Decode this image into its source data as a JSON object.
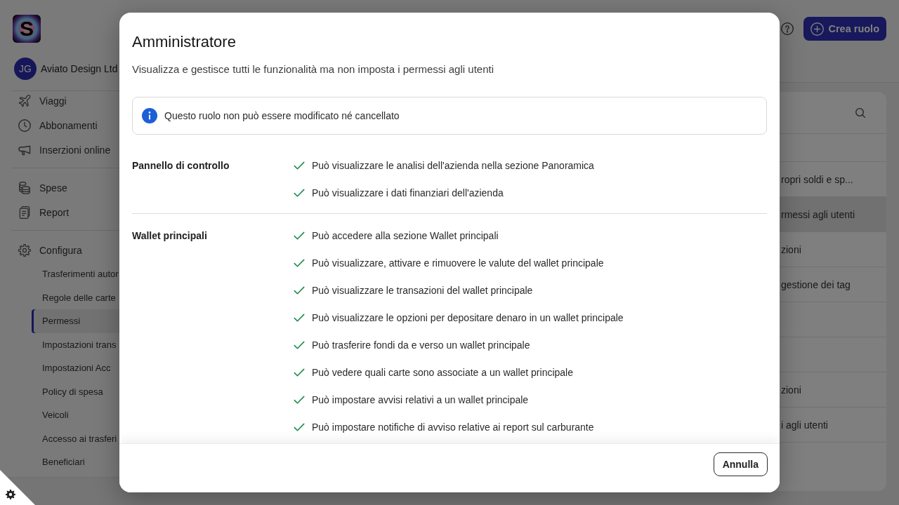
{
  "sidebar": {
    "logo": {
      "letter": "S"
    },
    "account": {
      "initials": "JG",
      "name": "Aviato Design Ltd"
    },
    "nav_groups": [
      {
        "items": [
          {
            "label": "Viaggi",
            "selected": false
          },
          {
            "label": "Abbonamenti",
            "selected": false
          },
          {
            "label": "Inserzioni online",
            "selected": false
          }
        ]
      },
      {
        "items": [
          {
            "label": "Spese",
            "selected": false
          },
          {
            "label": "Report",
            "selected": false
          }
        ]
      },
      {
        "items": [
          {
            "label": "Configura",
            "selected": false,
            "children": [
              {
                "label": "Trasferimenti autor",
                "selected": false
              },
              {
                "label": "Regole delle carte",
                "selected": false
              },
              {
                "label": "Permessi",
                "selected": true
              },
              {
                "label": "Impostazioni trans",
                "selected": false
              },
              {
                "label": "Impostazioni Acc",
                "selected": false
              },
              {
                "label": "Policy di spesa",
                "selected": false
              },
              {
                "label": "Veicoli",
                "selected": false
              },
              {
                "label": "Accesso ai trasferi",
                "selected": false
              },
              {
                "label": "Beneficiari",
                "selected": false
              }
            ]
          }
        ]
      }
    ]
  },
  "header": {
    "create_button": {
      "label": "Crea ruolo"
    }
  },
  "roles_list": {
    "rows": [
      {
        "text": "ropri soldi e sp...",
        "selected": false
      },
      {
        "text": "rmessi agli utenti",
        "selected": true
      },
      {
        "text": "zioni",
        "selected": false
      },
      {
        "text": "gestione dei tag",
        "selected": false
      },
      {
        "selected": false
      },
      {
        "selected": false
      },
      {
        "text": "zioni",
        "selected": false
      },
      {
        "text": "i agli utenti",
        "selected": false
      }
    ]
  },
  "dialog": {
    "title": "Amministratore",
    "description": "Visualizza e gestisce tutti le funzionalità ma non imposta i permessi agli utenti",
    "notice": "Questo ruolo non può essere modificato né cancellato",
    "sections": [
      {
        "name": "Pannello di controllo",
        "permissions": [
          "Può visualizzare le analisi dell'azienda nella sezione Panoramica",
          "Può visualizzare i dati finanziari dell'azienda"
        ]
      },
      {
        "name": "Wallet principali",
        "permissions": [
          "Può accedere alla sezione Wallet principali",
          "Può visualizzare, attivare e rimuovere le valute del wallet principale",
          "Può visualizzare le transazioni del wallet principale",
          "Può visualizzare le opzioni per depositare denaro in un wallet principale",
          "Può trasferire fondi da e verso un wallet principale",
          "Può vedere quali carte sono associate a un wallet principale",
          "Può impostare avvisi relativi a un wallet principale",
          "Può impostare notifiche di avviso relative ai report sul carburante"
        ]
      }
    ],
    "cancel_button": "Annulla"
  }
}
